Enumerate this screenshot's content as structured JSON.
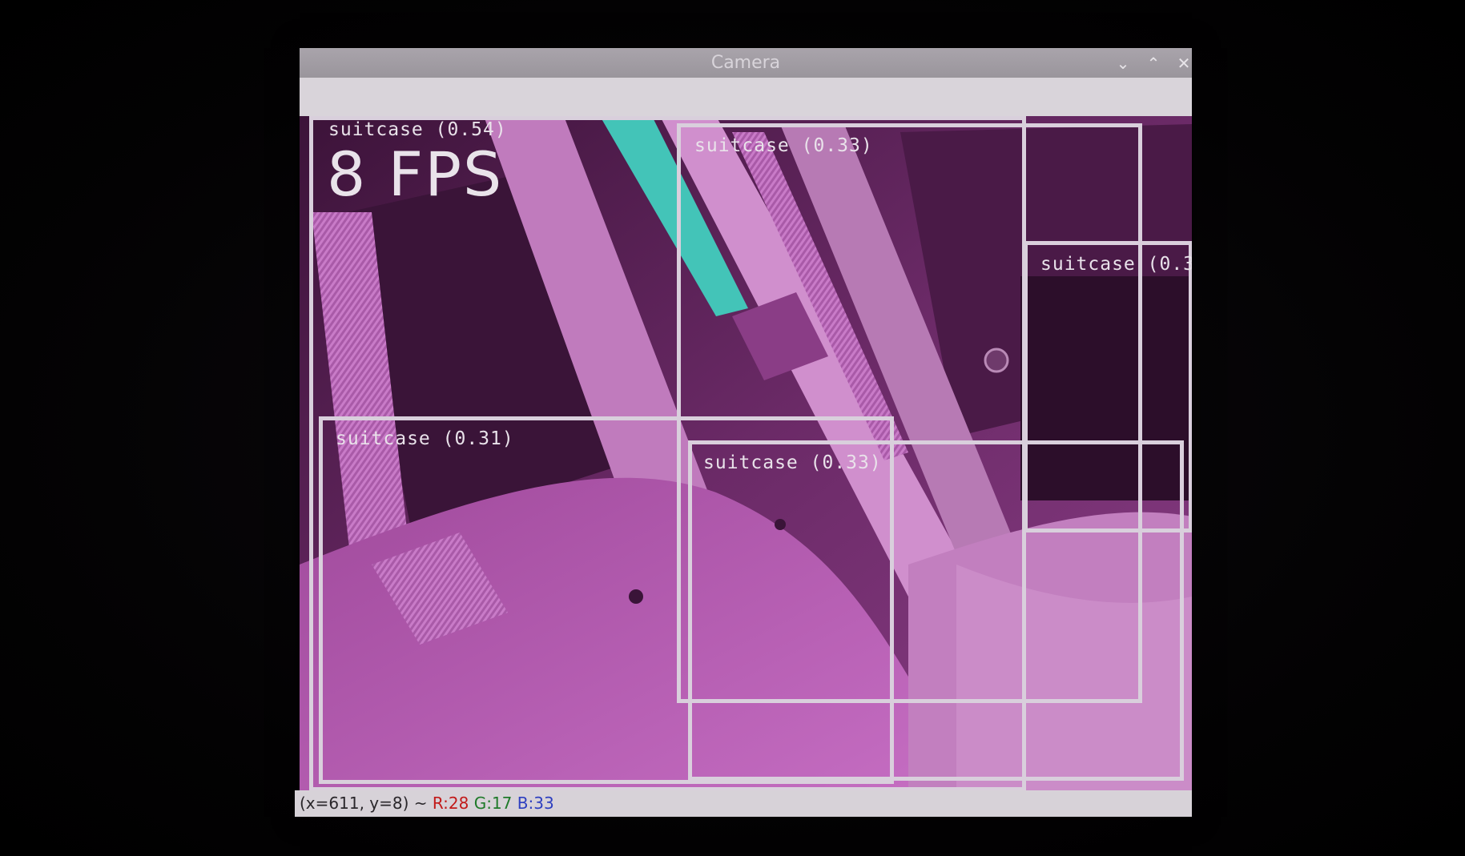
{
  "window": {
    "title": "Camera",
    "controls": {
      "minimize": "⌄",
      "maximize": "⌃",
      "close": "✕"
    }
  },
  "overlay": {
    "fps": "8 FPS",
    "detections": [
      {
        "label": "suitcase (0.54)"
      },
      {
        "label": "suitcase (0.33)"
      },
      {
        "label": "suitcase (0.3"
      },
      {
        "label": "suitcase (0.31)"
      },
      {
        "label": "suitcase (0.33)"
      }
    ]
  },
  "status": {
    "coord": "(x=611, y=8) ~ ",
    "r": "R:28",
    "g": "G:17",
    "b": "B:33"
  },
  "colors": {
    "image_tint": "#b44fb2",
    "box": "#d9cfdc",
    "cyan_strip": "#43c4b8"
  }
}
